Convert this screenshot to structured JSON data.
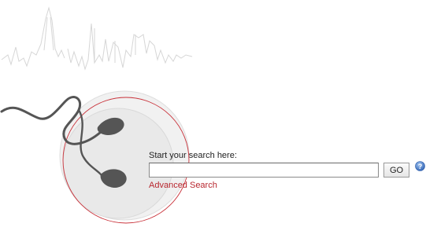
{
  "search": {
    "prompt": "Start your search here:",
    "query_value": "",
    "placeholder": "",
    "go_label": "GO",
    "advanced_label": "Advanced Search"
  },
  "icons": {
    "help": "help-question-icon",
    "skyline": "city-skyline-soundwave-icon",
    "headphones": "earphones-icon"
  },
  "colors": {
    "link": "#b8272f",
    "circle_outline": "#c9323a",
    "earphone": "#555555",
    "help_icon": "#3f78c8"
  }
}
